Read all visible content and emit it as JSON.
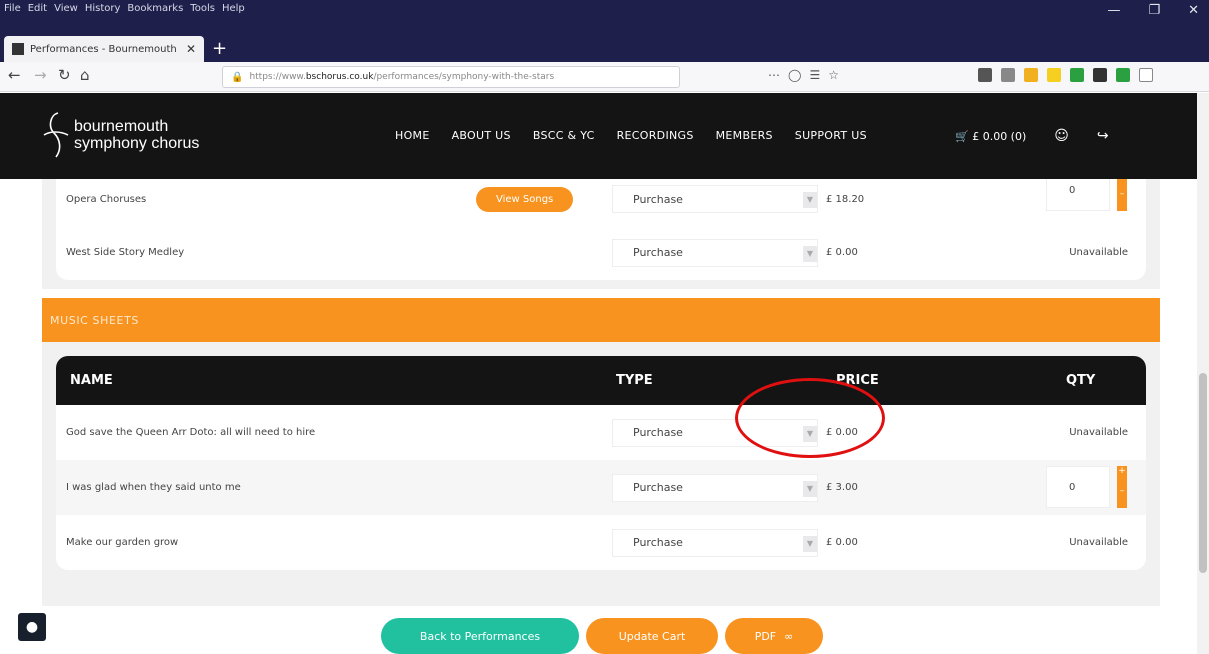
{
  "browser": {
    "menu": [
      "File",
      "Edit",
      "View",
      "History",
      "Bookmarks",
      "Tools",
      "Help"
    ],
    "tab_title": "Performances - Bournemouth",
    "url_prefix": "https://www.",
    "url_domain": "bschorus.co.uk",
    "url_path": "/performances/symphony-with-the-stars"
  },
  "site": {
    "logo_line1": "bournemouth",
    "logo_line2": "symphony chorus",
    "nav": [
      "HOME",
      "ABOUT US",
      "BSCC & YC",
      "RECORDINGS",
      "MEMBERS",
      "SUPPORT US"
    ],
    "cart_label": "£ 0.00 (0)"
  },
  "top_section": {
    "rows": [
      {
        "name": "Opera Choruses",
        "button": "View Songs",
        "type": "Purchase",
        "price": "£ 18.20",
        "qty": "0",
        "status": ""
      },
      {
        "name": "West Side Story Medley",
        "button": "",
        "type": "Purchase",
        "price": "£ 0.00",
        "qty": "",
        "status": "Unavailable"
      }
    ]
  },
  "music_sheets": {
    "section_title": "MUSIC SHEETS",
    "headers": {
      "name": "NAME",
      "type": "TYPE",
      "price": "PRICE",
      "qty": "QTY"
    },
    "rows": [
      {
        "name": "God save the Queen Arr Doto: all will need to hire",
        "type": "Purchase",
        "price": "£ 0.00",
        "qty": "",
        "status": "Unavailable"
      },
      {
        "name": "I was glad when they said unto me",
        "type": "Purchase",
        "price": "£ 3.00",
        "qty": "0",
        "status": ""
      },
      {
        "name": "Make our garden grow",
        "type": "Purchase",
        "price": "£ 0.00",
        "qty": "",
        "status": "Unavailable"
      }
    ]
  },
  "actions": {
    "back": "Back to Performances",
    "update": "Update Cart",
    "pdf": "PDF"
  },
  "colors": {
    "accent": "#f7931e",
    "teal": "#21c1a0",
    "dark": "#141414",
    "annotation": "#e01010"
  }
}
